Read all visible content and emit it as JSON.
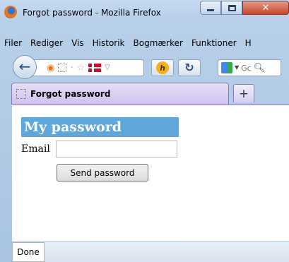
{
  "window": {
    "title": "Forgot password - Mozilla Firefox"
  },
  "menubar": {
    "items": [
      "Filer",
      "Rediger",
      "Vis",
      "Historik",
      "Bogmærker",
      "Funktioner",
      "H"
    ]
  },
  "navbar": {
    "search_placeholder": "Gc"
  },
  "tabs": {
    "active_title": "Forgot password",
    "new_tab_label": "+"
  },
  "page": {
    "banner": "My password",
    "email_label": "Email",
    "email_value": "",
    "send_button": "Send password"
  },
  "status": {
    "text": "Done"
  },
  "colors": {
    "banner_bg": "#5fa7da",
    "tab_active": "#cfc2ee",
    "close_button": "#c7462c"
  }
}
